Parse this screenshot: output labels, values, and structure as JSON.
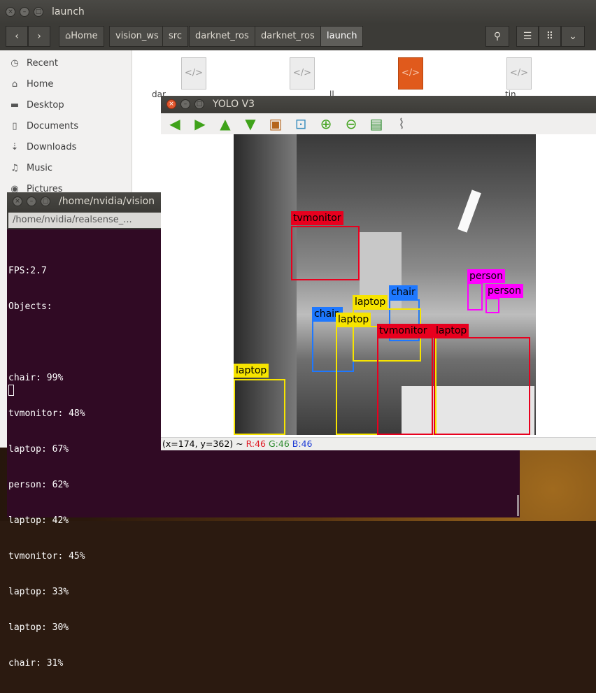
{
  "file_manager": {
    "title": "launch",
    "breadcrumbs": [
      "Home",
      "vision_ws",
      "src",
      "darknet_ros",
      "darknet_ros",
      "launch"
    ],
    "sidebar": [
      {
        "icon": "clock-icon",
        "label": "Recent"
      },
      {
        "icon": "home-icon",
        "label": "Home"
      },
      {
        "icon": "folder-icon",
        "label": "Desktop"
      },
      {
        "icon": "document-icon",
        "label": "Documents"
      },
      {
        "icon": "download-icon",
        "label": "Downloads"
      },
      {
        "icon": "music-icon",
        "label": "Music"
      },
      {
        "icon": "camera-icon",
        "label": "Pictures"
      }
    ],
    "files": [
      "dar",
      "ll",
      "",
      "tin"
    ]
  },
  "terminal": {
    "title": "/home/nvidia/vision",
    "tab": "/home/nvidia/realsense_...",
    "lines": [
      "FPS:2.7",
      "Objects:",
      "",
      "chair: 99%",
      "tvmonitor: 48%",
      "laptop: 67%",
      "person: 62%",
      "laptop: 42%",
      "tvmonitor: 45%",
      "laptop: 33%",
      "laptop: 30%",
      "chair: 31%"
    ]
  },
  "yolo": {
    "title": "YOLO V3",
    "status_coords": "(x=174, y=362) ~",
    "status_r": "R:46",
    "status_g": "G:46",
    "status_b": "B:46",
    "colors": {
      "red": "#e8001e",
      "yellow": "#f7e400",
      "blue": "#1e78ff",
      "magenta": "#ff00ff"
    },
    "detections": [
      {
        "label": "tvmonitor",
        "color": "red"
      },
      {
        "label": "person",
        "color": "magenta"
      },
      {
        "label": "person",
        "color": "magenta"
      },
      {
        "label": "chair",
        "color": "blue"
      },
      {
        "label": "chair",
        "color": "blue"
      },
      {
        "label": "laptop",
        "color": "yellow"
      },
      {
        "label": "laptop",
        "color": "yellow"
      },
      {
        "label": "tvmonitor",
        "color": "red"
      },
      {
        "label": "laptop",
        "color": "red"
      },
      {
        "label": "laptop",
        "color": "yellow"
      }
    ]
  }
}
